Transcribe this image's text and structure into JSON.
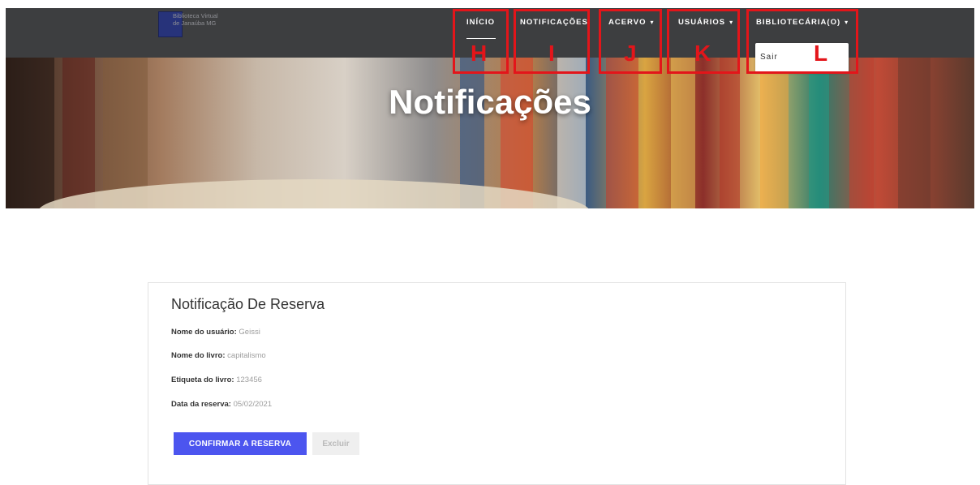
{
  "header": {
    "brand_line1": "Biblioteca Virtual",
    "brand_line2": "de Janaúba MG",
    "nav": {
      "inicio": "INÍCIO",
      "notificacoes": "NOTIFICAÇÕES",
      "acervo": "ACERVO",
      "usuarios": "USUÁRIOS",
      "bibliotecaria": "BIBLIOTECÁRIA(O)"
    },
    "caret": "▾",
    "dropdown": {
      "sair": "Sair"
    }
  },
  "annotations": {
    "h": "H",
    "i": "I",
    "j": "J",
    "k": "K",
    "l": "L",
    "color": "#e3151a"
  },
  "hero": {
    "title": "Notificações"
  },
  "card": {
    "title": "Notificação De Reserva",
    "fields": [
      {
        "label": "Nome do usuário:",
        "value": "Geissi"
      },
      {
        "label": "Nome do livro:",
        "value": "capitalismo"
      },
      {
        "label": "Etiqueta do livro:",
        "value": "123456"
      },
      {
        "label": "Data da reserva:",
        "value": "05/02/2021"
      }
    ],
    "confirm_label": "CONFIRMAR A RESERVA",
    "delete_label": "Excluir"
  },
  "colors": {
    "topbar": "#3d3e40",
    "accent": "#4c55ef",
    "annotation_red": "#e3151a"
  }
}
